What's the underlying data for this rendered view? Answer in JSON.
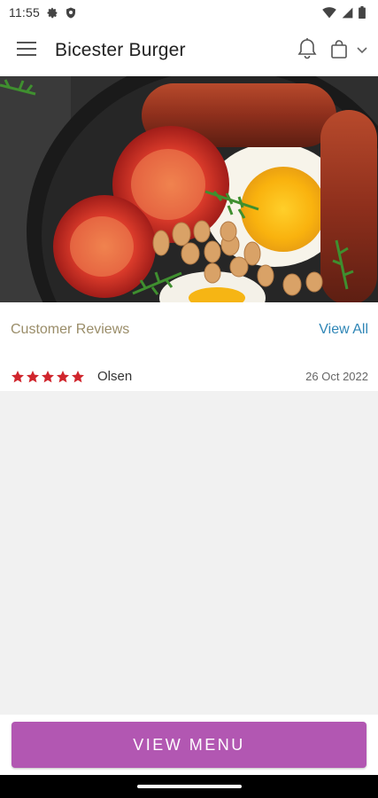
{
  "status_bar": {
    "time": "11:55",
    "icons": [
      "gear-icon",
      "shield-icon",
      "wifi-icon",
      "signal-icon",
      "battery-icon"
    ]
  },
  "app_bar": {
    "title": "Bicester Burger",
    "icons": [
      "hamburger-menu-icon",
      "bell-icon",
      "shopping-bag-icon",
      "chevron-down-icon"
    ]
  },
  "hero": {
    "description_icon": "food-photo"
  },
  "reviews": {
    "title": "Customer Reviews",
    "view_all_label": "View All",
    "items": [
      {
        "rating": 5,
        "reviewer": "Olsen",
        "date": "26 Oct 2022"
      }
    ]
  },
  "cta": {
    "label": "VIEW MENU"
  },
  "colors": {
    "accent": "#b257b2",
    "link": "#2f86b6",
    "section_title": "#9a8d69",
    "star": "#d0262d"
  }
}
